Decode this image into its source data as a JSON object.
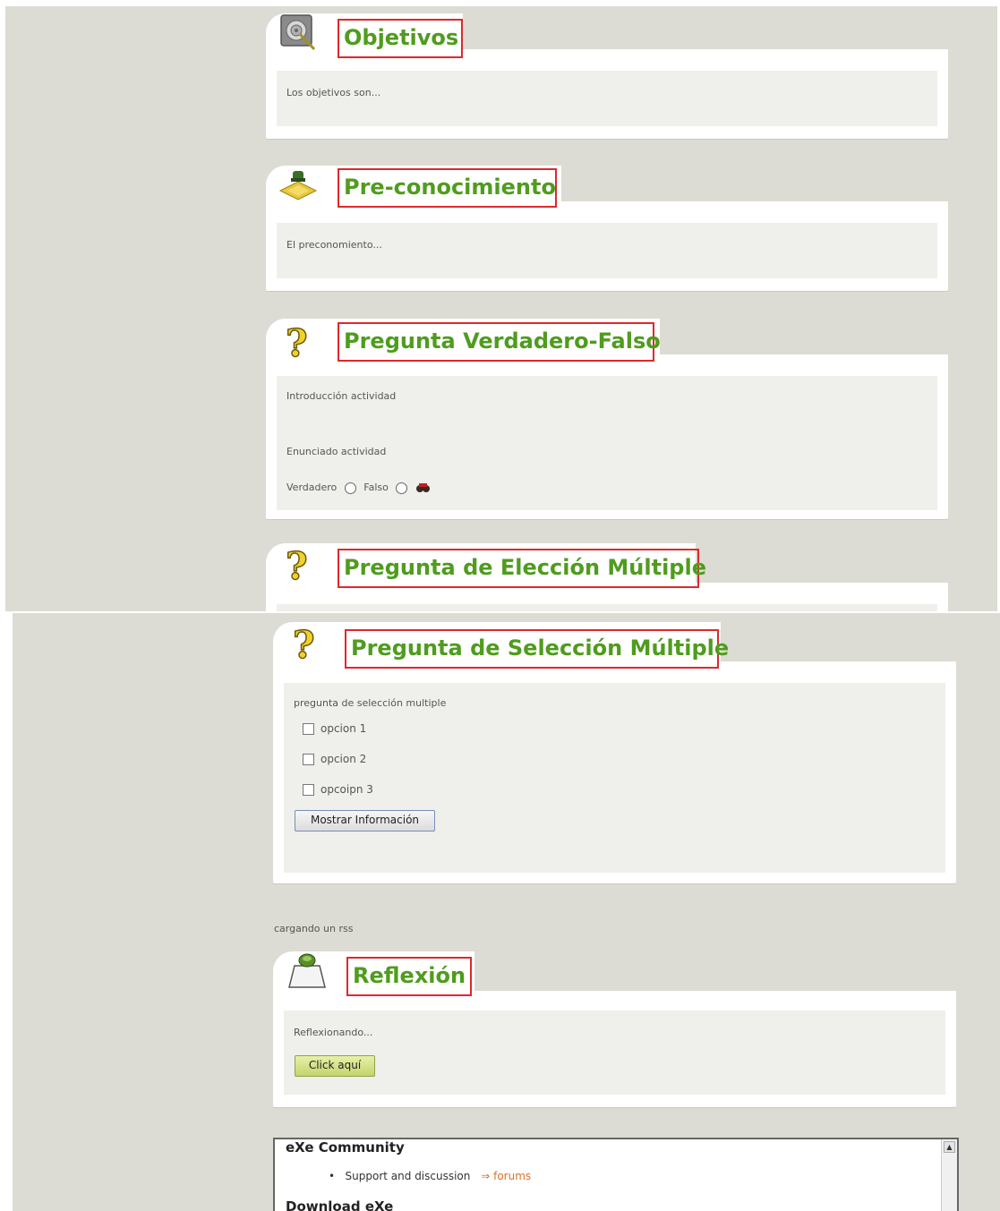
{
  "top": {
    "objetivos": {
      "title": "Objetivos",
      "body": "Los objetivos son..."
    },
    "preconocimiento": {
      "title": "Pre-conocimiento",
      "body": "El preconomiento..."
    },
    "verdadero_falso": {
      "title": "Pregunta Verdadero-Falso",
      "intro": "Introducción actividad",
      "statement": "Enunciado actividad",
      "option_true": "Verdadero",
      "option_false": "Falso"
    },
    "eleccion_multiple": {
      "title": "Pregunta de Elección Múltiple"
    }
  },
  "bottom": {
    "seleccion_multiple": {
      "title": "Pregunta de Selección Múltiple",
      "question": "pregunta de selección multiple",
      "options": [
        "opcion 1",
        "opcion 2",
        "opcoipn 3"
      ],
      "button": "Mostrar Información"
    },
    "rss_text": "cargando un rss",
    "reflexion": {
      "title": "Reflexión",
      "body": "Reflexionando...",
      "button": "Click aquí"
    },
    "footer": {
      "heading": "eXe Community",
      "item_text": "Support and discussion",
      "link": "forums",
      "heading2": "Download eXe"
    }
  },
  "colors": {
    "title_green": "#4f9c1e",
    "highlight_red": "#e0282c",
    "background": "#dcdcd4"
  }
}
